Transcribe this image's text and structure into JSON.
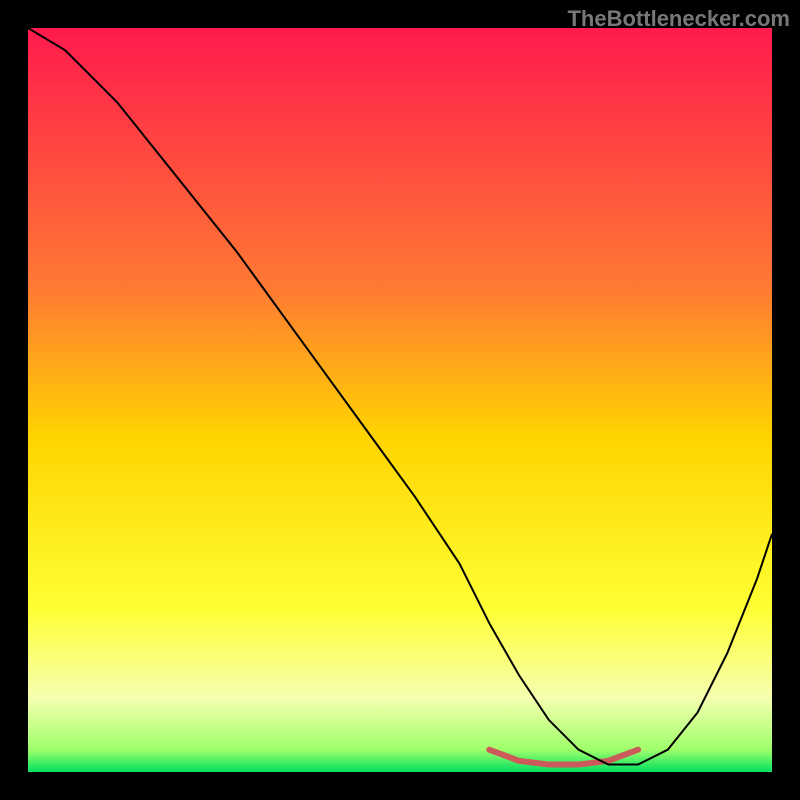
{
  "watermark": "TheBottlenecker.com",
  "chart_data": {
    "type": "line",
    "title": "",
    "xlabel": "",
    "ylabel": "",
    "xlim": [
      0,
      100
    ],
    "ylim": [
      0,
      100
    ],
    "gradient": {
      "stops": [
        {
          "offset": 0,
          "color": "#ff1a4d"
        },
        {
          "offset": 35,
          "color": "#ff7a33"
        },
        {
          "offset": 55,
          "color": "#ffd400"
        },
        {
          "offset": 78,
          "color": "#ffff33"
        },
        {
          "offset": 90,
          "color": "#f6ffb0"
        },
        {
          "offset": 97,
          "color": "#9fff6a"
        },
        {
          "offset": 100,
          "color": "#00e060"
        }
      ]
    },
    "series": [
      {
        "name": "bottleneck-curve",
        "color": "#000000",
        "width": 2,
        "x": [
          0,
          5,
          12,
          20,
          28,
          36,
          44,
          52,
          58,
          62,
          66,
          70,
          74,
          78,
          82,
          86,
          90,
          94,
          98,
          100
        ],
        "values": [
          100,
          97,
          90,
          80,
          70,
          59,
          48,
          37,
          28,
          20,
          13,
          7,
          3,
          1,
          1,
          3,
          8,
          16,
          26,
          32
        ]
      }
    ],
    "flat_band": {
      "color": "#cc5a5a",
      "width": 6,
      "x": [
        62,
        66,
        70,
        74,
        78,
        82
      ],
      "values": [
        3,
        1.5,
        1,
        1,
        1.5,
        3
      ]
    }
  }
}
